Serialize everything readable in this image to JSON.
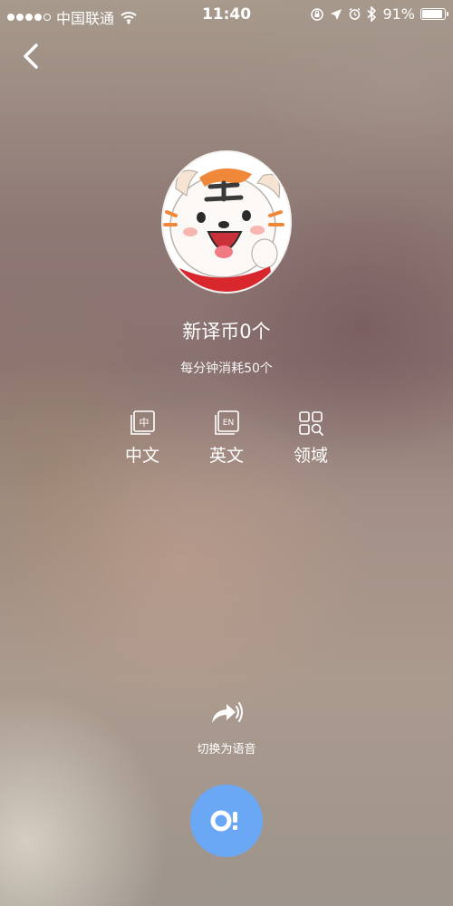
{
  "status_bar": {
    "carrier": "中国联通",
    "time": "11:40",
    "battery_percent": "91%",
    "battery_level": 0.91,
    "icons": [
      "signal-dots",
      "wifi-icon",
      "orientation-lock-icon",
      "location-icon",
      "alarm-icon",
      "bluetooth-icon",
      "battery-icon"
    ]
  },
  "header": {
    "back_icon": "chevron-left-icon"
  },
  "profile": {
    "avatar": "tiger-mascot-avatar",
    "coin_text": "新译币0个",
    "cost_text": "每分钟消耗50个"
  },
  "options": [
    {
      "icon": "chinese-language-icon",
      "icon_text": "中",
      "label": "中文"
    },
    {
      "icon": "english-language-icon",
      "icon_text": "EN",
      "label": "英文"
    },
    {
      "icon": "domain-grid-icon",
      "label": "领域"
    }
  ],
  "switch_voice": {
    "icon": "share-voice-icon",
    "label": "切换为语音"
  },
  "mic": {
    "icon": "voice-record-icon",
    "accent_color": "#6aa8f5"
  }
}
